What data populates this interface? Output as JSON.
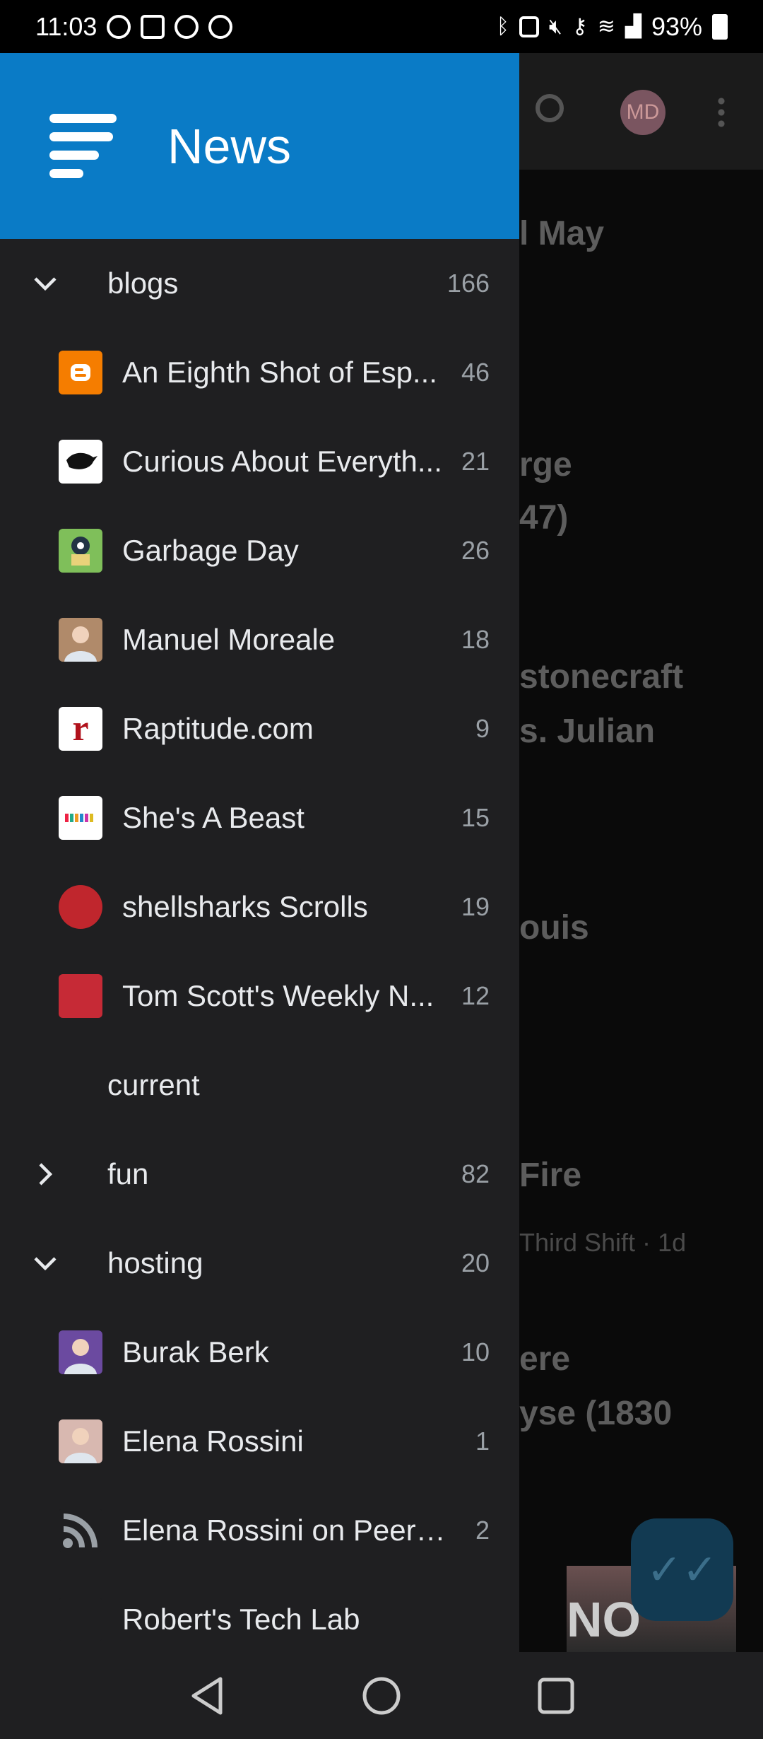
{
  "status_bar": {
    "time": "11:03",
    "battery": "93%"
  },
  "background": {
    "avatar_initials": "MD",
    "lines": [
      {
        "text": "l May",
        "kind": "title"
      },
      {
        "text": "rge",
        "kind": "title"
      },
      {
        "text": "47)",
        "kind": "title"
      },
      {
        "text": "stonecraft",
        "kind": "title"
      },
      {
        "text": "s. Julian",
        "kind": "title"
      },
      {
        "text": "ouis",
        "kind": "title"
      },
      {
        "text": "Fire",
        "kind": "title"
      },
      {
        "text": "Third Shift · 1d",
        "kind": "sub"
      },
      {
        "text": "ere",
        "kind": "title"
      },
      {
        "text": "yse (1830",
        "kind": "title"
      }
    ],
    "thumb_text": "NO"
  },
  "drawer": {
    "title": "News",
    "rows": [
      {
        "type": "folder",
        "label": "blogs",
        "count": "166",
        "expanded": true
      },
      {
        "type": "feed",
        "label": "An Eighth Shot of Esp...",
        "count": "46",
        "icon": "blogger-icon",
        "color": "#f57d00"
      },
      {
        "type": "feed",
        "label": "Curious About Everyth...",
        "count": "21",
        "icon": "crow-icon",
        "color": "#ffffff"
      },
      {
        "type": "feed",
        "label": "Garbage Day",
        "count": "26",
        "icon": "garbage-day-icon",
        "color": "#7fbf5a"
      },
      {
        "type": "feed",
        "label": "Manuel Moreale",
        "count": "18",
        "icon": "person-avatar-icon",
        "color": "#b08a6a"
      },
      {
        "type": "feed",
        "label": "Raptitude.com",
        "count": "9",
        "icon": "raptitude-icon",
        "color": "#ffffff"
      },
      {
        "type": "feed",
        "label": "She's A Beast",
        "count": "15",
        "icon": "shes-a-beast-icon",
        "color": "#ffffff"
      },
      {
        "type": "feed",
        "label": "shellsharks Scrolls",
        "count": "19",
        "icon": "shellsharks-icon",
        "color": "#c0262d"
      },
      {
        "type": "feed",
        "label": "Tom Scott's Weekly N...",
        "count": "12",
        "icon": "tom-scott-icon",
        "color": "#c62a36"
      },
      {
        "type": "folder",
        "label": "current",
        "count": "",
        "expanded": null
      },
      {
        "type": "folder",
        "label": "fun",
        "count": "82",
        "expanded": false
      },
      {
        "type": "folder",
        "label": "hosting",
        "count": "20",
        "expanded": true
      },
      {
        "type": "feed",
        "label": "Burak Berk",
        "count": "10",
        "icon": "burak-avatar-icon",
        "color": "#6b4aa0"
      },
      {
        "type": "feed",
        "label": "Elena Rossini",
        "count": "1",
        "icon": "elena-avatar-icon",
        "color": "#d8b8b0"
      },
      {
        "type": "feed",
        "label": "Elena Rossini on PeerT...",
        "count": "2",
        "icon": "rss-icon",
        "color": "#1f1f21"
      },
      {
        "type": "feed",
        "label": "Robert's Tech Lab",
        "count": "",
        "icon": "robert-icon",
        "color": "#1f1f21"
      }
    ]
  }
}
